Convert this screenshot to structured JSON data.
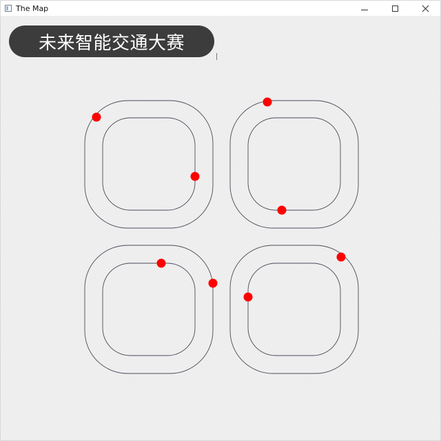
{
  "window": {
    "title": "The Map",
    "controls": {
      "minimize": "minimize",
      "maximize": "maximize",
      "close": "close"
    }
  },
  "banner": {
    "text": "未来智能交通大赛"
  },
  "colors": {
    "car": "#ff0000",
    "track": "#4a4a5a",
    "banner_bg": "#3c3c3c",
    "banner_text": "#ffffff"
  },
  "map": {
    "loops": 4,
    "lanes_per_loop": 2,
    "cars": 8
  }
}
